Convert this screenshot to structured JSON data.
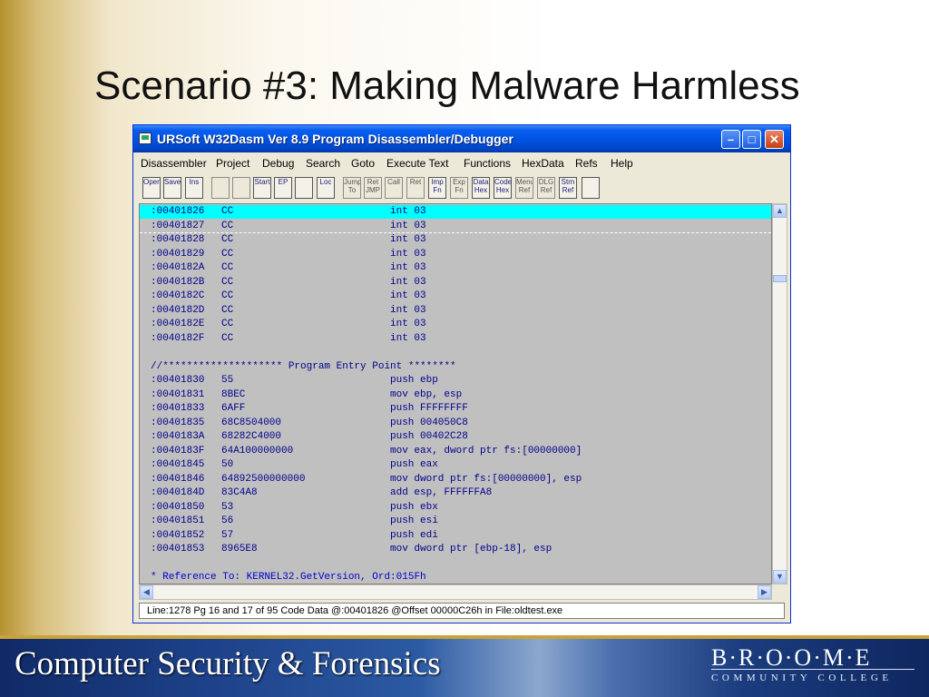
{
  "slide": {
    "title": "Scenario #3: Making Malware Harmless"
  },
  "window": {
    "title": "URSoft W32Dasm Ver 8.9 Program Disassembler/Debugger",
    "minimize": "–",
    "maximize": "□",
    "close": "✕"
  },
  "menu": [
    "Disassembler",
    "Project",
    "Debug",
    "Search",
    "Goto",
    "Execute Text",
    "Functions",
    "HexData",
    "Refs",
    "Help"
  ],
  "toolbar": [
    {
      "label": "Open",
      "icon": "open-file-icon",
      "enabled": true
    },
    {
      "label": "Save",
      "icon": "save-icon",
      "enabled": true
    },
    {
      "label": "Ins",
      "icon": "pen-icon",
      "enabled": true
    },
    {
      "label": "",
      "icon": "load-icon",
      "enabled": false
    },
    {
      "label": "",
      "icon": "step-icon",
      "enabled": false
    },
    {
      "label": "Start",
      "icon": "run-start-icon",
      "enabled": true
    },
    {
      "label": "EP",
      "icon": "entry-point-icon",
      "enabled": true
    },
    {
      "label": "",
      "icon": "goto-icon",
      "enabled": true
    },
    {
      "label": "Loc",
      "icon": "code-location-icon",
      "enabled": true
    },
    {
      "label": "Jump To",
      "icon": "jump-to-icon",
      "enabled": false
    },
    {
      "label": "Ret JMP",
      "icon": "ret-jmp-icon",
      "enabled": false
    },
    {
      "label": "Call",
      "icon": "call-icon",
      "enabled": false
    },
    {
      "label": "Ret",
      "icon": "ret-icon",
      "enabled": false
    },
    {
      "label": "Imp Fn",
      "icon": "import-fn-icon",
      "enabled": true
    },
    {
      "label": "Exp Fn",
      "icon": "export-fn-icon",
      "enabled": false
    },
    {
      "label": "Data Hex",
      "icon": "data-hex-icon",
      "enabled": true
    },
    {
      "label": "Code Hex",
      "icon": "code-hex-icon",
      "enabled": true
    },
    {
      "label": "Menu Ref",
      "icon": "menu-ref-icon",
      "enabled": false
    },
    {
      "label": "DLG Ref",
      "icon": "dlg-ref-icon",
      "enabled": false
    },
    {
      "label": "Strn Ref",
      "icon": "string-ref-icon",
      "enabled": true
    },
    {
      "label": "",
      "icon": "print-icon",
      "enabled": true
    }
  ],
  "code": [
    {
      "addr": ":00401826",
      "hex": "CC",
      "instr": "int 03",
      "selected": true
    },
    {
      "addr": ":00401827",
      "hex": "CC",
      "instr": "int 03"
    },
    {
      "addr": ":00401828",
      "hex": "CC",
      "instr": "int 03"
    },
    {
      "addr": ":00401829",
      "hex": "CC",
      "instr": "int 03"
    },
    {
      "addr": ":0040182A",
      "hex": "CC",
      "instr": "int 03"
    },
    {
      "addr": ":0040182B",
      "hex": "CC",
      "instr": "int 03"
    },
    {
      "addr": ":0040182C",
      "hex": "CC",
      "instr": "int 03"
    },
    {
      "addr": ":0040182D",
      "hex": "CC",
      "instr": "int 03"
    },
    {
      "addr": ":0040182E",
      "hex": "CC",
      "instr": "int 03"
    },
    {
      "addr": ":0040182F",
      "hex": "CC",
      "instr": "int 03"
    },
    {
      "text": ""
    },
    {
      "text": "//******************** Program Entry Point ********"
    },
    {
      "addr": ":00401830",
      "hex": "55",
      "instr": "push ebp"
    },
    {
      "addr": ":00401831",
      "hex": "8BEC",
      "instr": "mov ebp, esp"
    },
    {
      "addr": ":00401833",
      "hex": "6AFF",
      "instr": "push FFFFFFFF"
    },
    {
      "addr": ":00401835",
      "hex": "68C8504000",
      "instr": "push 004050C8"
    },
    {
      "addr": ":0040183A",
      "hex": "68282C4000",
      "instr": "push 00402C28"
    },
    {
      "addr": ":0040183F",
      "hex": "64A100000000",
      "instr": "mov eax, dword ptr fs:[00000000]"
    },
    {
      "addr": ":00401845",
      "hex": "50",
      "instr": "push eax"
    },
    {
      "addr": ":00401846",
      "hex": "64892500000000",
      "instr": "mov dword ptr fs:[00000000], esp"
    },
    {
      "addr": ":0040184D",
      "hex": "83C4A8",
      "instr": "add esp, FFFFFFA8"
    },
    {
      "addr": ":00401850",
      "hex": "53",
      "instr": "push ebx"
    },
    {
      "addr": ":00401851",
      "hex": "56",
      "instr": "push esi"
    },
    {
      "addr": ":00401852",
      "hex": "57",
      "instr": "push edi"
    },
    {
      "addr": ":00401853",
      "hex": "8965E8",
      "instr": "mov dword ptr [ebp-18], esp"
    },
    {
      "text": ""
    },
    {
      "text": "* Reference To: KERNEL32.GetVersion, Ord:015Fh"
    }
  ],
  "status": "Line:1278 Pg 16 and 17 of 95  Code Data @:00401826 @Offset 00000C26h in File:oldtest.exe",
  "footer": {
    "course": "Computer Security & Forensics",
    "college": "B·R·O·O·M·E",
    "college_sub": "COMMUNITY COLLEGE"
  },
  "colors": {
    "selection": "#00ffff",
    "code_bg": "#c0c0c0",
    "code_text": "#00008b",
    "titlebar": "#0054e3"
  }
}
